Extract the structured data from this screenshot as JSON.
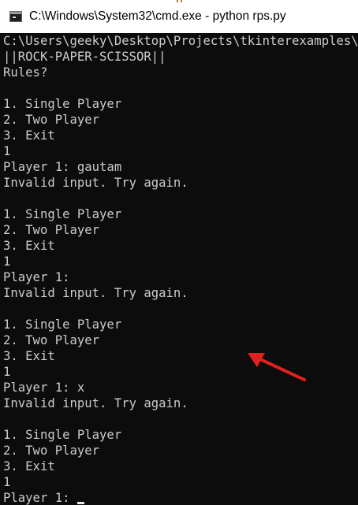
{
  "window": {
    "title": "C:\\Windows\\System32\\cmd.exe - python  rps.py",
    "icon": "cmd-icon"
  },
  "console": {
    "lines": [
      "C:\\Users\\geeky\\Desktop\\Projects\\tkinterexamples\\RO",
      "||ROCK-PAPER-SCISSOR||",
      "Rules?",
      "",
      "1. Single Player",
      "2. Two Player",
      "3. Exit",
      "1",
      "Player 1: gautam",
      "Invalid input. Try again.",
      "",
      "1. Single Player",
      "2. Two Player",
      "3. Exit",
      "1",
      "Player 1:",
      "Invalid input. Try again.",
      "",
      "1. Single Player",
      "2. Two Player",
      "3. Exit",
      "1",
      "Player 1: x",
      "Invalid input. Try again.",
      "",
      "1. Single Player",
      "2. Two Player",
      "3. Exit",
      "1",
      "Player 1: "
    ]
  },
  "annotation": {
    "arrow_color": "#e0211e"
  }
}
